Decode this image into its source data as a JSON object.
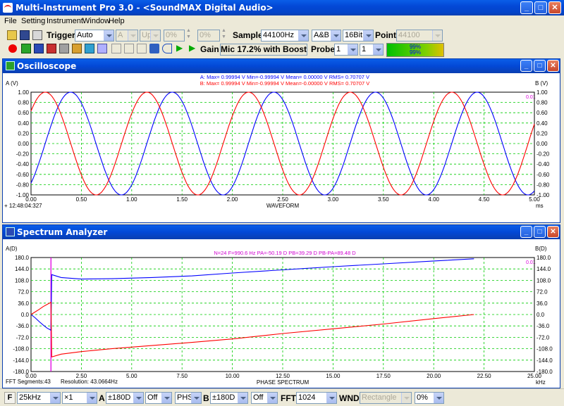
{
  "window": {
    "title": "Multi-Instrument Pro 3.0 - <SoundMAX Digital Audio>"
  },
  "menu": [
    "File",
    "Setting",
    "Instrument",
    "Window",
    "Help"
  ],
  "toolbar1": {
    "trigger_label": "Trigger",
    "trigger_mode": "Auto",
    "channel": "A",
    "edge": "Up",
    "level1": "0%",
    "level2": "0%",
    "sample_label": "Sample",
    "sample_rate": "44100Hz",
    "channels": "A&B",
    "bits": "16Bit",
    "point_label": "Point",
    "points": "44100"
  },
  "toolbar2": {
    "gain_label": "Gain",
    "mic_text": "Mic 17.2% with Boost",
    "probe_label": "Probe",
    "probe_a": "1",
    "probe_b": "1",
    "meter_a": "99%",
    "meter_b": "99%"
  },
  "oscilloscope": {
    "title": "Oscilloscope",
    "stats_a": "A: Max= 0.99994 V  Min=-0.99994 V  Mean= 0.00000 V  RMS= 0.70707 V",
    "stats_b": "B: Max= 0.99994 V  Min=-0.99994 V  Mean=-0.00000 V  RMS= 0.70707 V",
    "left_axis": "A (V)",
    "right_axis": "B (V)",
    "xlabel": "WAVEFORM",
    "xunit": "ms",
    "timestamp": "+ 12:48:04:327",
    "marker": "0.01",
    "colors": {
      "a": "#0000ff",
      "b": "#ff0000",
      "grid": "#00cc00"
    }
  },
  "spectrum": {
    "title": "Spectrum Analyzer",
    "stats": "N=24   F=990.6 Hz  PA=-50.19 D   PB=39.29 D   PB-PA=89.48 D",
    "left_axis": "A(D)",
    "right_axis": "B(D)",
    "xlabel": "PHASE SPECTRUM",
    "xunit": "kHz",
    "fft_segments": "FFT Segments:43",
    "resolution": "Resolution: 43.0664Hz",
    "marker": "0.01"
  },
  "statusbar": {
    "f_label": "F",
    "freq_range": "25kHz",
    "zoom": "×1",
    "a_label": "A",
    "a_range": "±180D",
    "a_off": "Off",
    "mode": "PHS",
    "b_label": "B",
    "b_range": "±180D",
    "b_off": "Off",
    "fft_label": "FFT",
    "fft_size": "1024",
    "wnd_label": "WND",
    "window_fn": "Rectangle",
    "overlap": "0%"
  },
  "chart_data": [
    {
      "type": "line",
      "title": "",
      "xlabel": "WAVEFORM",
      "ylabel": "A (V)",
      "y2label": "B (V)",
      "xlim": [
        0,
        5
      ],
      "ylim": [
        -1,
        1
      ],
      "x_ticks": [
        "0.00",
        "0.50",
        "1.00",
        "1.50",
        "2.00",
        "2.50",
        "3.00",
        "3.50",
        "4.00",
        "4.50",
        "5.00"
      ],
      "y_ticks": [
        "1.00",
        "0.80",
        "0.60",
        "0.40",
        "0.20",
        "0.00",
        "-0.20",
        "-0.40",
        "-0.60",
        "-0.80",
        "-1.00"
      ],
      "grid": true,
      "series": [
        {
          "name": "A",
          "frequency_khz": 0.9906,
          "amplitude": 1.0,
          "phase_deg": -50.19,
          "color": "#0000ff"
        },
        {
          "name": "B",
          "frequency_khz": 0.9906,
          "amplitude": 1.0,
          "phase_deg": 39.29,
          "color": "#ff0000"
        }
      ]
    },
    {
      "type": "line",
      "title": "",
      "xlabel": "PHASE SPECTRUM",
      "ylabel": "A(D)",
      "y2label": "B(D)",
      "xlim": [
        0,
        25
      ],
      "ylim": [
        -180,
        180
      ],
      "x_ticks": [
        "0.00",
        "2.50",
        "5.00",
        "7.50",
        "10.00",
        "12.50",
        "15.00",
        "17.50",
        "20.00",
        "22.50",
        "25.00"
      ],
      "y_ticks": [
        "180.0",
        "144.0",
        "108.0",
        "72.0",
        "36.0",
        "0.0",
        "-36.0",
        "-72.0",
        "-108.0",
        "-144.0",
        "-180.0"
      ],
      "grid": true,
      "cursor_x": 0.99,
      "series": [
        {
          "name": "A",
          "color": "#0000ff",
          "x": [
            0,
            0.2,
            0.4,
            0.6,
            0.8,
            0.95,
            0.99,
            1.03,
            1.5,
            2.5,
            4,
            6,
            8,
            10,
            12.5,
            15,
            17.5,
            20,
            22
          ],
          "y": [
            0,
            -10,
            -22,
            -33,
            -43,
            -48,
            -50,
            126,
            117,
            112,
            113,
            117,
            122,
            131,
            141,
            151,
            160,
            169,
            176
          ]
        },
        {
          "name": "B",
          "color": "#ff0000",
          "x": [
            0,
            0.2,
            0.4,
            0.6,
            0.8,
            0.95,
            0.99,
            1.03,
            1.5,
            2.5,
            4,
            6,
            8,
            10,
            12.5,
            15,
            17.5,
            20,
            22
          ],
          "y": [
            0,
            8,
            16,
            25,
            32,
            37,
            39,
            -134,
            -125,
            -117,
            -108,
            -98,
            -88,
            -77,
            -60,
            -45,
            -30,
            -13,
            0
          ]
        }
      ]
    }
  ]
}
